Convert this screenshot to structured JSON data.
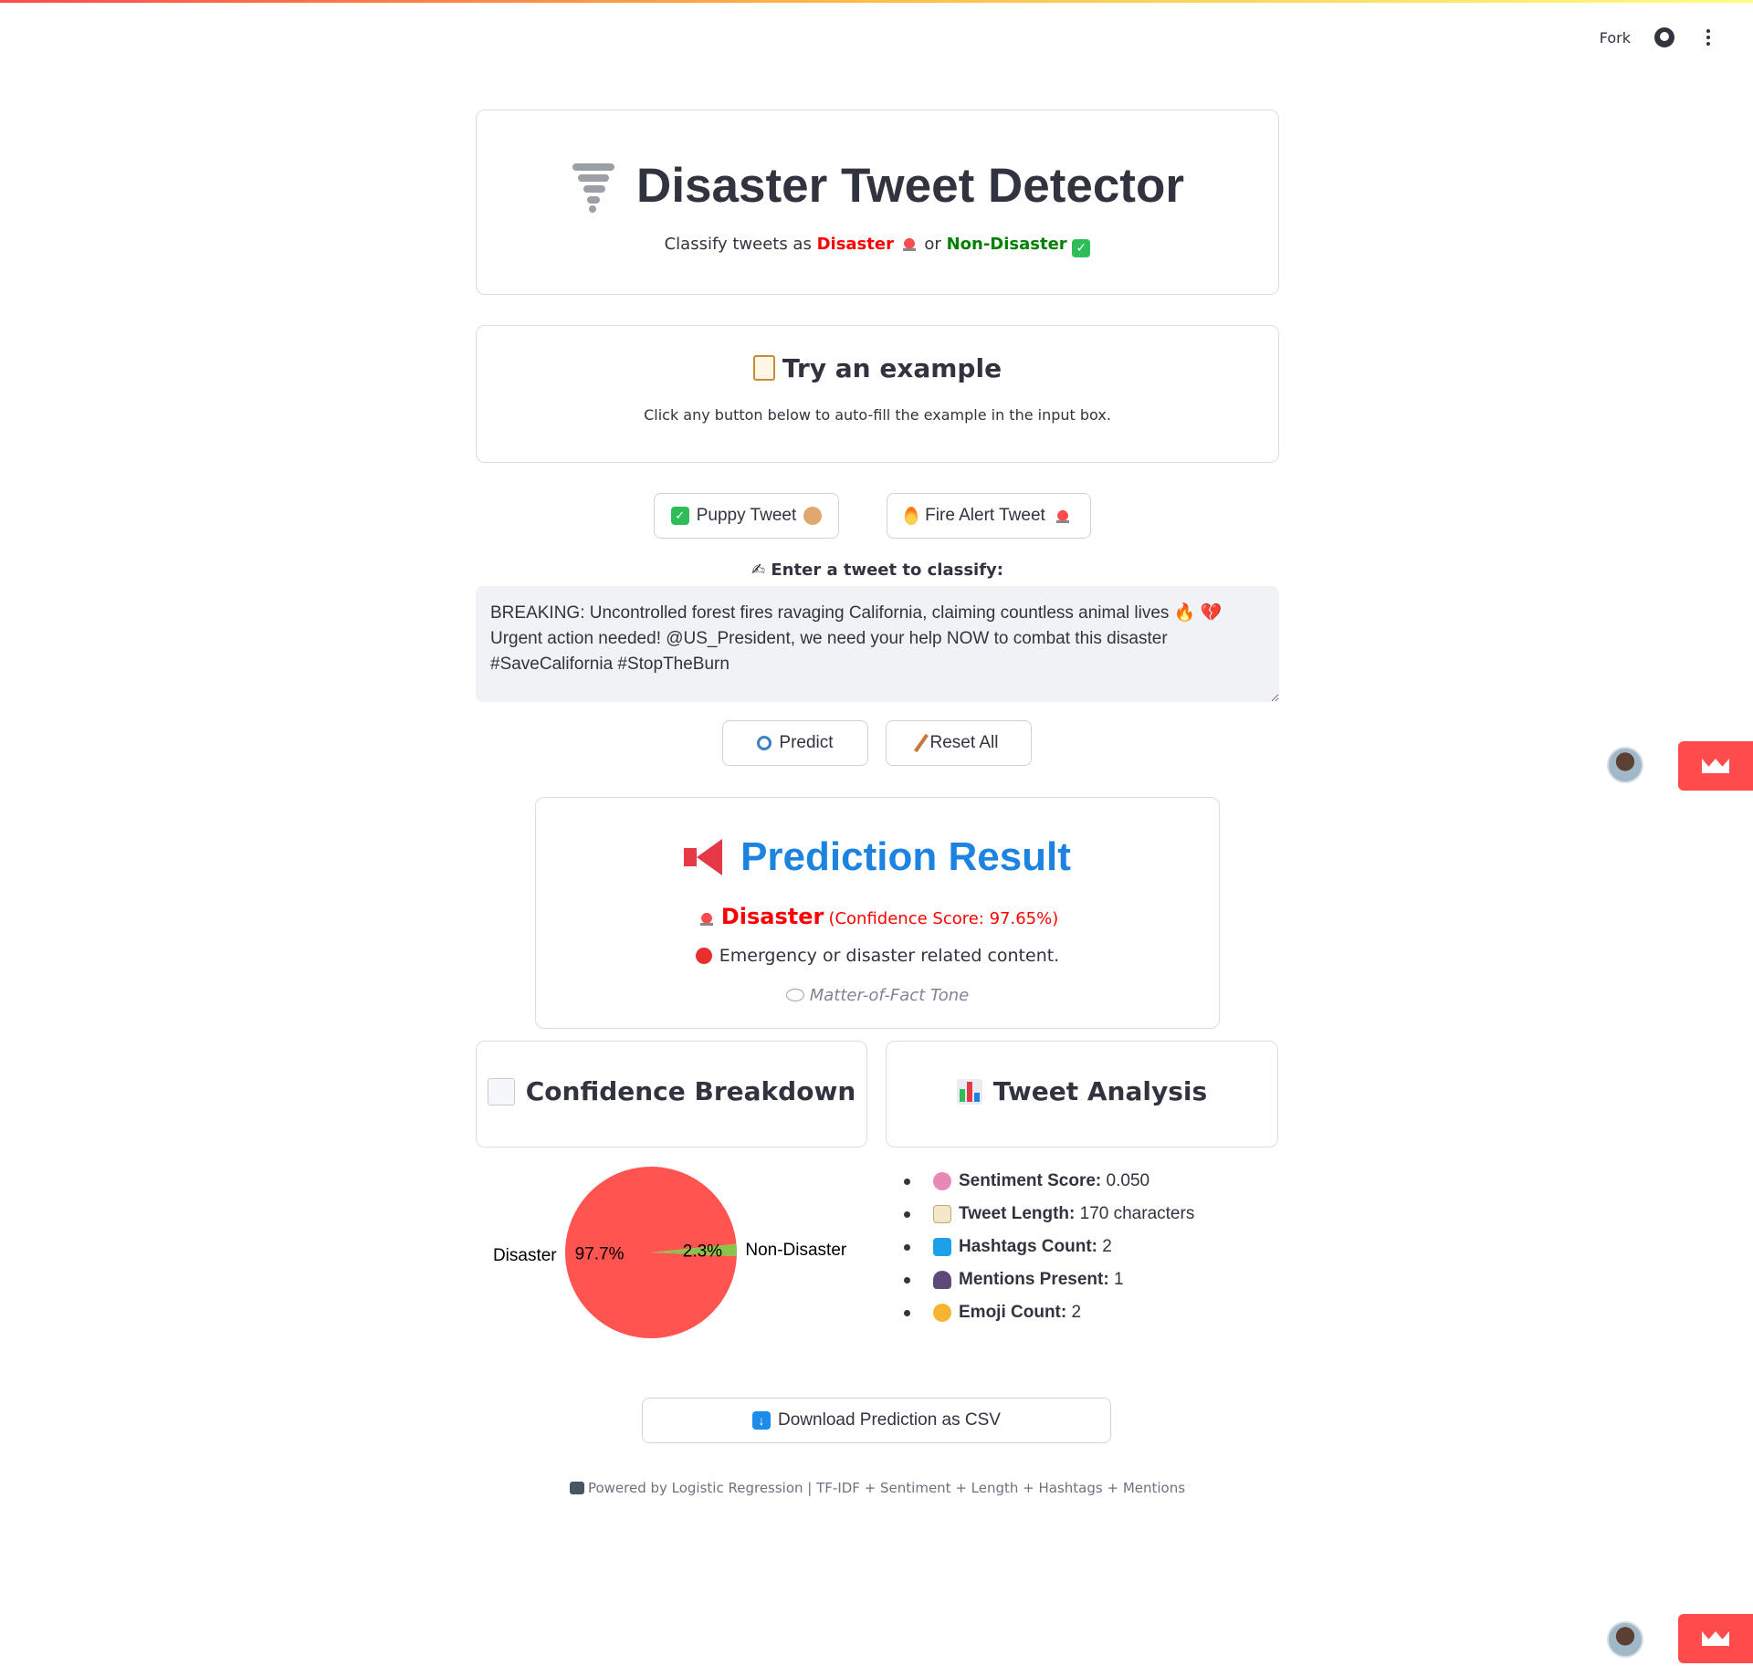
{
  "header": {
    "fork_label": "Fork",
    "github_icon": "github-icon",
    "menu_icon": "more-vertical-icon"
  },
  "title_card": {
    "title": "Disaster Tweet Detector",
    "icon": "tornado-icon",
    "subtitle_prefix": "Classify tweets as",
    "disaster_label": "Disaster",
    "connector": "or",
    "non_disaster_label": "Non-Disaster"
  },
  "example_card": {
    "title": "Try an example",
    "icon": "clipboard-icon",
    "subtitle": "Click any button below to auto-fill the example in the input box."
  },
  "example_buttons": {
    "puppy_label": "Puppy Tweet",
    "fire_label": "Fire Alert Tweet"
  },
  "input": {
    "label": "Enter a tweet to classify:",
    "value": "BREAKING: Uncontrolled forest fires ravaging California, claiming countless animal lives 🔥 💔 Urgent action needed! @US_President, we need your help NOW to combat this disaster #SaveCalifornia #StopTheBurn"
  },
  "actions": {
    "predict_label": "Predict",
    "reset_label": "Reset All"
  },
  "result": {
    "title": "Prediction Result",
    "label": "Disaster",
    "confidence_text": "(Confidence Score: 97.65%)",
    "description": "Emergency or disaster related content.",
    "tone": "Matter-of-Fact Tone",
    "color": "#ff0000"
  },
  "confidence_section": {
    "title": "Confidence Breakdown"
  },
  "analysis_section": {
    "title": "Tweet Analysis",
    "items": [
      {
        "label": "Sentiment Score:",
        "value": "0.050",
        "icon": "brain-icon"
      },
      {
        "label": "Tweet Length:",
        "value": "170 characters",
        "icon": "memo-icon"
      },
      {
        "label": "Hashtags Count:",
        "value": "2",
        "icon": "hash-icon"
      },
      {
        "label": "Mentions Present:",
        "value": "1",
        "icon": "people-icon"
      },
      {
        "label": "Emoji Count:",
        "value": "2",
        "icon": "smile-icon"
      }
    ]
  },
  "chart_data": {
    "type": "pie",
    "categories": [
      "Disaster",
      "Non-Disaster"
    ],
    "values": [
      97.7,
      2.3
    ],
    "labels": [
      "97.7%",
      "2.3%"
    ],
    "colors": [
      "#ff5450",
      "#8bc34a"
    ]
  },
  "download": {
    "label": "Download Prediction as CSV"
  },
  "footer": {
    "text": "Powered by Logistic Regression | TF-IDF + Sentiment + Length + Hashtags + Mentions"
  }
}
